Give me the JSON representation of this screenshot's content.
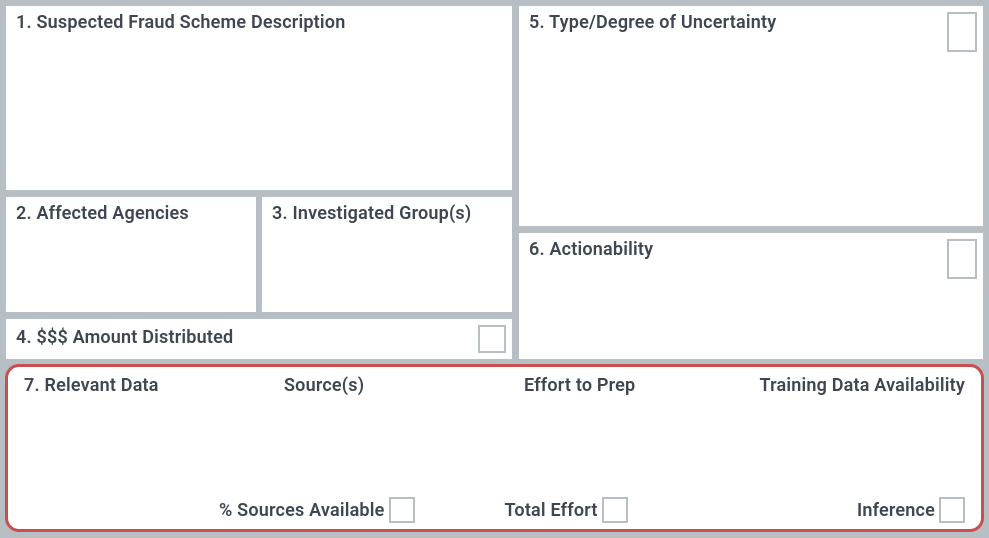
{
  "section1": {
    "title": "1. Suspected Fraud Scheme Description"
  },
  "section2": {
    "title": "2. Affected Agencies"
  },
  "section3": {
    "title": "3. Investigated Group(s)"
  },
  "section4": {
    "title": "4. $$$ Amount Distributed"
  },
  "section5": {
    "title": "5. Type/Degree of Uncertainty"
  },
  "section6": {
    "title": "6. Actionability"
  },
  "section7": {
    "title": "7. Relevant Data",
    "col_sources": "Source(s)",
    "col_effort": "Effort to Prep",
    "col_training": "Training Data Availability",
    "pct_sources_label": "% Sources Available",
    "total_effort_label": "Total Effort",
    "inference_label": "Inference"
  }
}
